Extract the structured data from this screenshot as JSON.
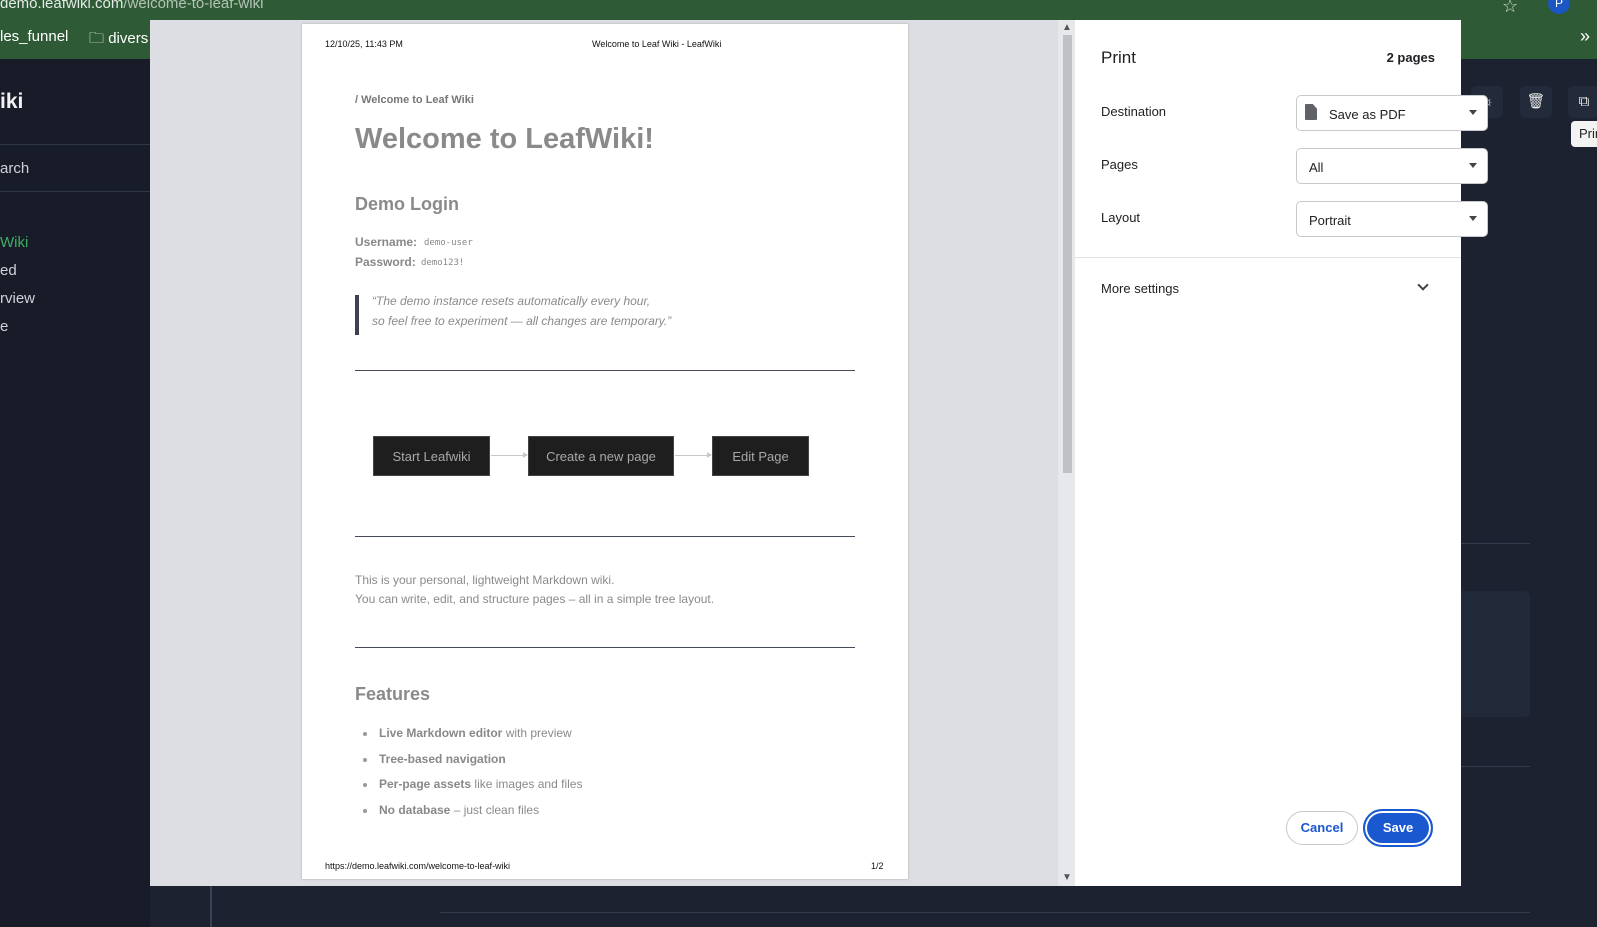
{
  "browser": {
    "url_host": "demo.leafwiki.com",
    "url_path": "/welcome-to-leaf-wiki",
    "profile_initial": "P",
    "bookmarks": [
      "les_funnel",
      "divers"
    ]
  },
  "app": {
    "title": "iki",
    "search": "arch",
    "nav_items": [
      "Wiki",
      "ed",
      "rview",
      "e"
    ],
    "tooltip": "Prin"
  },
  "print": {
    "title": "Print",
    "page_count": "2 pages",
    "destination": {
      "label": "Destination",
      "value": "Save as PDF"
    },
    "pages": {
      "label": "Pages",
      "value": "All"
    },
    "layout": {
      "label": "Layout",
      "value": "Portrait"
    },
    "more_settings": "More settings",
    "cancel": "Cancel",
    "save": "Save"
  },
  "preview": {
    "header_date": "12/10/25, 11:43 PM",
    "header_title": "Welcome to Leaf Wiki - LeafWiki",
    "footer_url": "https://demo.leafwiki.com/welcome-to-leaf-wiki",
    "footer_page": "1/2",
    "breadcrumb": "/ Welcome to Leaf Wiki",
    "h1": "Welcome to LeafWiki!",
    "demo_login": "Demo Login",
    "username_label": "Username:",
    "username_value": "demo-user",
    "password_label": "Password:",
    "password_value": "demo123!",
    "quote_line1": "“The demo instance resets automatically every hour,",
    "quote_line2": "so feel free to experiment — all changes are temporary.”",
    "flow": [
      "Start Leafwiki",
      "Create a new page",
      "Edit Page"
    ],
    "para_line1": "This is your personal, lightweight Markdown wiki.",
    "para_line2": "You can write, edit, and structure pages – all in a simple tree layout.",
    "features_heading": "Features",
    "features": [
      {
        "bold": "Live Markdown editor",
        "rest": " with preview"
      },
      {
        "bold": "Tree-based navigation",
        "rest": ""
      },
      {
        "bold": "Per-page assets",
        "rest": " like images and files"
      },
      {
        "bold": "No database",
        "rest": " – just clean files"
      }
    ]
  },
  "colors": {
    "chrome_green": "#2e5b36",
    "app_bg": "#1c2230",
    "accent_blue": "#1a58d0",
    "active_nav": "#3fae63"
  }
}
